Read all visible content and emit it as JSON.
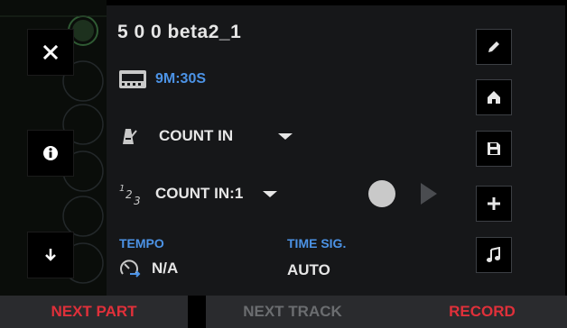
{
  "project": {
    "title": "5 0 0 beta2_1",
    "duration": "9M:30S"
  },
  "count_in": {
    "mode_label": "COUNT IN",
    "bars_label": "COUNT IN:1"
  },
  "tempo": {
    "label": "TEMPO",
    "value": "N/A"
  },
  "time_sig": {
    "label": "TIME SIG.",
    "value": "AUTO"
  },
  "bottom_bar": {
    "next_part": "NEXT PART",
    "next_track": "NEXT TRACK",
    "record": "RECORD"
  },
  "icons": {
    "close": "close-icon",
    "info": "info-icon",
    "down": "arrow-down-icon",
    "pencil": "pencil-icon",
    "home": "home-icon",
    "save": "save-icon",
    "add": "plus-icon",
    "music": "music-note-icon",
    "duration": "film-strip-icon",
    "metronome": "metronome-icon",
    "count": "count-icon",
    "tempo": "tempo-gauge-icon"
  },
  "colors": {
    "accent_blue": "#4c93e6",
    "record_red": "#e0303a",
    "disabled_gray": "#6b6d70",
    "panel": "#161719",
    "bottom_bar": "#2a2b2e"
  }
}
